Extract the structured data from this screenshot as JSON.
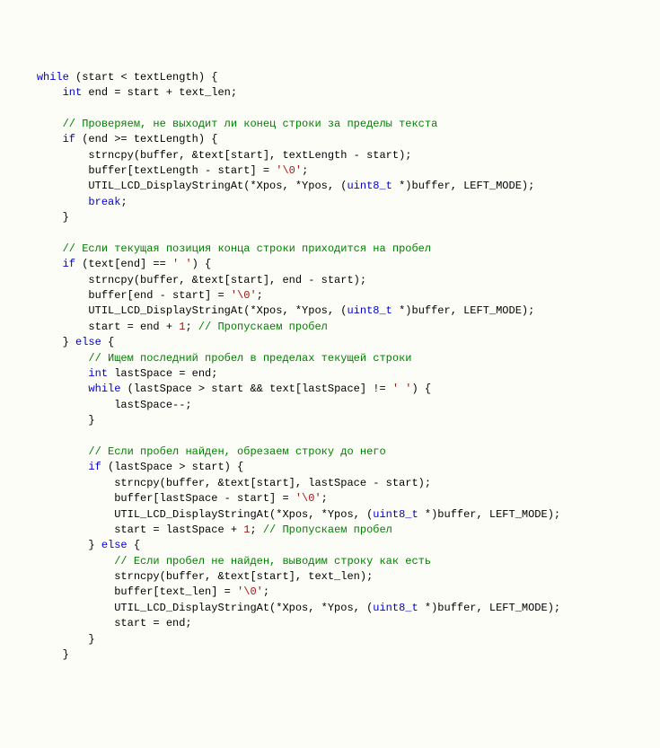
{
  "code": {
    "lines": [
      {
        "indent": 1,
        "tokens": [
          {
            "t": "kw",
            "v": "while"
          },
          {
            "t": "pl",
            "v": " (start < textLength) {"
          }
        ]
      },
      {
        "indent": 2,
        "tokens": [
          {
            "t": "ty",
            "v": "int"
          },
          {
            "t": "pl",
            "v": " end = start + text_len;"
          }
        ]
      },
      {
        "indent": 0,
        "tokens": [
          {
            "t": "pl",
            "v": ""
          }
        ]
      },
      {
        "indent": 2,
        "tokens": [
          {
            "t": "cm",
            "v": "// Проверяем, не выходит ли конец строки за пределы текста"
          }
        ]
      },
      {
        "indent": 2,
        "tokens": [
          {
            "t": "kw",
            "v": "if"
          },
          {
            "t": "pl",
            "v": " (end >= textLength) {"
          }
        ]
      },
      {
        "indent": 3,
        "tokens": [
          {
            "t": "pl",
            "v": "strncpy(buffer, &text[start], textLength - start);"
          }
        ]
      },
      {
        "indent": 3,
        "tokens": [
          {
            "t": "pl",
            "v": "buffer[textLength - start] = "
          },
          {
            "t": "st",
            "v": "'\\0'"
          },
          {
            "t": "pl",
            "v": ";"
          }
        ]
      },
      {
        "indent": 3,
        "tokens": [
          {
            "t": "pl",
            "v": "UTIL_LCD_DisplayStringAt(*Xpos, *Ypos, ("
          },
          {
            "t": "ty",
            "v": "uint8_t"
          },
          {
            "t": "pl",
            "v": " *)buffer, LEFT_MODE);"
          }
        ]
      },
      {
        "indent": 3,
        "tokens": [
          {
            "t": "kw",
            "v": "break"
          },
          {
            "t": "pl",
            "v": ";"
          }
        ]
      },
      {
        "indent": 2,
        "tokens": [
          {
            "t": "pl",
            "v": "}"
          }
        ]
      },
      {
        "indent": 0,
        "tokens": [
          {
            "t": "pl",
            "v": ""
          }
        ]
      },
      {
        "indent": 2,
        "tokens": [
          {
            "t": "cm",
            "v": "// Если текущая позиция конца строки приходится на пробел"
          }
        ]
      },
      {
        "indent": 2,
        "tokens": [
          {
            "t": "kw",
            "v": "if"
          },
          {
            "t": "pl",
            "v": " (text[end] == "
          },
          {
            "t": "st",
            "v": "' '"
          },
          {
            "t": "pl",
            "v": ") {"
          }
        ]
      },
      {
        "indent": 3,
        "tokens": [
          {
            "t": "pl",
            "v": "strncpy(buffer, &text[start], end - start);"
          }
        ]
      },
      {
        "indent": 3,
        "tokens": [
          {
            "t": "pl",
            "v": "buffer[end - start] = "
          },
          {
            "t": "st",
            "v": "'\\0'"
          },
          {
            "t": "pl",
            "v": ";"
          }
        ]
      },
      {
        "indent": 3,
        "tokens": [
          {
            "t": "pl",
            "v": "UTIL_LCD_DisplayStringAt(*Xpos, *Ypos, ("
          },
          {
            "t": "ty",
            "v": "uint8_t"
          },
          {
            "t": "pl",
            "v": " *)buffer, LEFT_MODE);"
          }
        ]
      },
      {
        "indent": 3,
        "tokens": [
          {
            "t": "pl",
            "v": "start = end + "
          },
          {
            "t": "nu",
            "v": "1"
          },
          {
            "t": "pl",
            "v": "; "
          },
          {
            "t": "cm",
            "v": "// Пропускаем пробел"
          }
        ]
      },
      {
        "indent": 2,
        "tokens": [
          {
            "t": "pl",
            "v": "} "
          },
          {
            "t": "kw",
            "v": "else"
          },
          {
            "t": "pl",
            "v": " {"
          }
        ]
      },
      {
        "indent": 3,
        "tokens": [
          {
            "t": "cm",
            "v": "// Ищем последний пробел в пределах текущей строки"
          }
        ]
      },
      {
        "indent": 3,
        "tokens": [
          {
            "t": "ty",
            "v": "int"
          },
          {
            "t": "pl",
            "v": " lastSpace = end;"
          }
        ]
      },
      {
        "indent": 3,
        "tokens": [
          {
            "t": "kw",
            "v": "while"
          },
          {
            "t": "pl",
            "v": " (lastSpace > start && text[lastSpace] != "
          },
          {
            "t": "st",
            "v": "' '"
          },
          {
            "t": "pl",
            "v": ") {"
          }
        ]
      },
      {
        "indent": 4,
        "tokens": [
          {
            "t": "pl",
            "v": "lastSpace--;"
          }
        ]
      },
      {
        "indent": 3,
        "tokens": [
          {
            "t": "pl",
            "v": "}"
          }
        ]
      },
      {
        "indent": 0,
        "tokens": [
          {
            "t": "pl",
            "v": ""
          }
        ]
      },
      {
        "indent": 3,
        "tokens": [
          {
            "t": "cm",
            "v": "// Если пробел найден, обрезаем строку до него"
          }
        ]
      },
      {
        "indent": 3,
        "tokens": [
          {
            "t": "kw",
            "v": "if"
          },
          {
            "t": "pl",
            "v": " (lastSpace > start) {"
          }
        ]
      },
      {
        "indent": 4,
        "tokens": [
          {
            "t": "pl",
            "v": "strncpy(buffer, &text[start], lastSpace - start);"
          }
        ]
      },
      {
        "indent": 4,
        "tokens": [
          {
            "t": "pl",
            "v": "buffer[lastSpace - start] = "
          },
          {
            "t": "st",
            "v": "'\\0'"
          },
          {
            "t": "pl",
            "v": ";"
          }
        ]
      },
      {
        "indent": 4,
        "tokens": [
          {
            "t": "pl",
            "v": "UTIL_LCD_DisplayStringAt(*Xpos, *Ypos, ("
          },
          {
            "t": "ty",
            "v": "uint8_t"
          },
          {
            "t": "pl",
            "v": " *)buffer, LEFT_MODE);"
          }
        ]
      },
      {
        "indent": 4,
        "tokens": [
          {
            "t": "pl",
            "v": "start = lastSpace + "
          },
          {
            "t": "nu",
            "v": "1"
          },
          {
            "t": "pl",
            "v": "; "
          },
          {
            "t": "cm",
            "v": "// Пропускаем пробел"
          }
        ]
      },
      {
        "indent": 3,
        "tokens": [
          {
            "t": "pl",
            "v": "} "
          },
          {
            "t": "kw",
            "v": "else"
          },
          {
            "t": "pl",
            "v": " {"
          }
        ]
      },
      {
        "indent": 4,
        "tokens": [
          {
            "t": "cm",
            "v": "// Если пробел не найден, выводим строку как есть"
          }
        ]
      },
      {
        "indent": 4,
        "tokens": [
          {
            "t": "pl",
            "v": "strncpy(buffer, &text[start], text_len);"
          }
        ]
      },
      {
        "indent": 4,
        "tokens": [
          {
            "t": "pl",
            "v": "buffer[text_len] = "
          },
          {
            "t": "st",
            "v": "'\\0'"
          },
          {
            "t": "pl",
            "v": ";"
          }
        ]
      },
      {
        "indent": 4,
        "tokens": [
          {
            "t": "pl",
            "v": "UTIL_LCD_DisplayStringAt(*Xpos, *Ypos, ("
          },
          {
            "t": "ty",
            "v": "uint8_t"
          },
          {
            "t": "pl",
            "v": " *)buffer, LEFT_MODE);"
          }
        ]
      },
      {
        "indent": 4,
        "tokens": [
          {
            "t": "pl",
            "v": "start = end;"
          }
        ]
      },
      {
        "indent": 3,
        "tokens": [
          {
            "t": "pl",
            "v": "}"
          }
        ]
      },
      {
        "indent": 2,
        "tokens": [
          {
            "t": "pl",
            "v": "}"
          }
        ]
      }
    ],
    "indent_unit": "    "
  }
}
